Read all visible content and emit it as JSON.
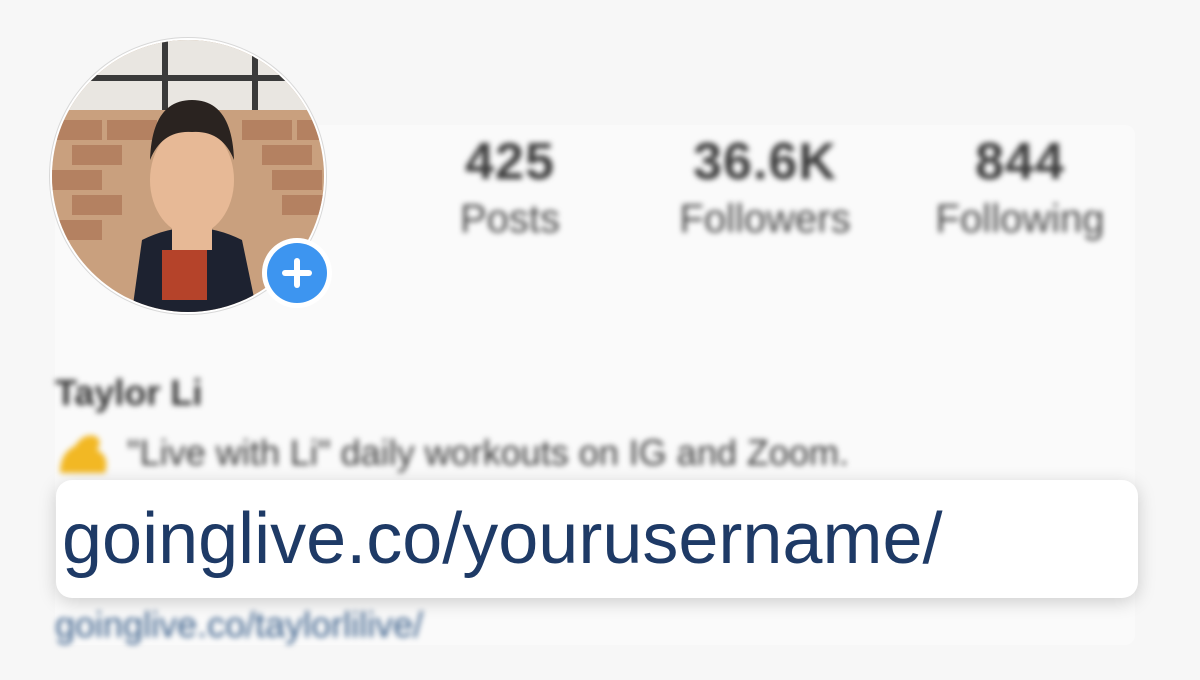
{
  "profile": {
    "name": "Taylor Li",
    "bio": "\"Live with Li\" daily workouts on IG and Zoom.",
    "link": "goinglive.co/taylorlilive/",
    "add_icon": "plus-icon"
  },
  "stats": [
    {
      "value": "425",
      "label": "Posts"
    },
    {
      "value": "36.6K",
      "label": "Followers"
    },
    {
      "value": "844",
      "label": "Following"
    }
  ],
  "overlay": {
    "url": "goinglive.co/yourusername/"
  },
  "colors": {
    "accent": "#3d95f0",
    "url_text": "#1e3a66",
    "link_text": "#3a5f8a"
  }
}
